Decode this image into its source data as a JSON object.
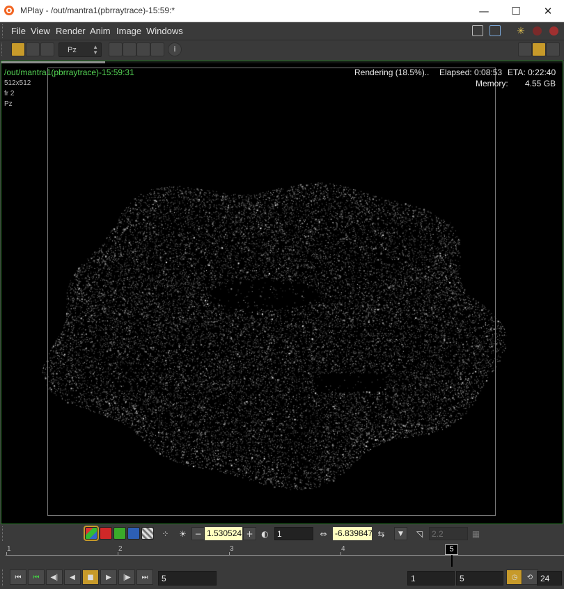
{
  "window": {
    "title": "MPlay - /out/mantra1(pbrraytrace)-15:59:*",
    "minimize_glyph": "—",
    "maximize_glyph": "☐",
    "close_glyph": "✕"
  },
  "menu": {
    "items": [
      "File",
      "View",
      "Render",
      "Anim",
      "Image",
      "Windows"
    ]
  },
  "toolbar": {
    "plane_select_value": "Pz",
    "info_glyph": "i"
  },
  "viewport": {
    "render_name": "/out/mantra1(pbrraytrace)-15:59:31",
    "resolution": "512x512",
    "frame": "fr 2",
    "plane": "Pz",
    "status": "Rendering (18.5%)..",
    "progress_fraction": 0.185,
    "elapsed": "Elapsed: 0:08:53",
    "eta": "ETA: 0:22:40",
    "memory_label": "Memory:",
    "memory_value": "4.55 GB"
  },
  "display_controls": {
    "minus_glyph": "−",
    "plus_glyph": "+",
    "gain_value": "1.530524",
    "gamma_value": "1",
    "offset_value": "-6.839847",
    "lut_gamma_value": "2.2"
  },
  "timeline": {
    "tick_labels": [
      "1",
      "2",
      "3",
      "4"
    ],
    "current_frame": "5"
  },
  "playbar": {
    "frame_value": "5",
    "range_start": "1",
    "range_end": "5",
    "fps": "24"
  },
  "colors": {
    "accent_green": "#55d655",
    "viewport_border": "#2d8a2d",
    "field_yellow": "#ffffc0",
    "active_orange": "#c79a2a"
  }
}
